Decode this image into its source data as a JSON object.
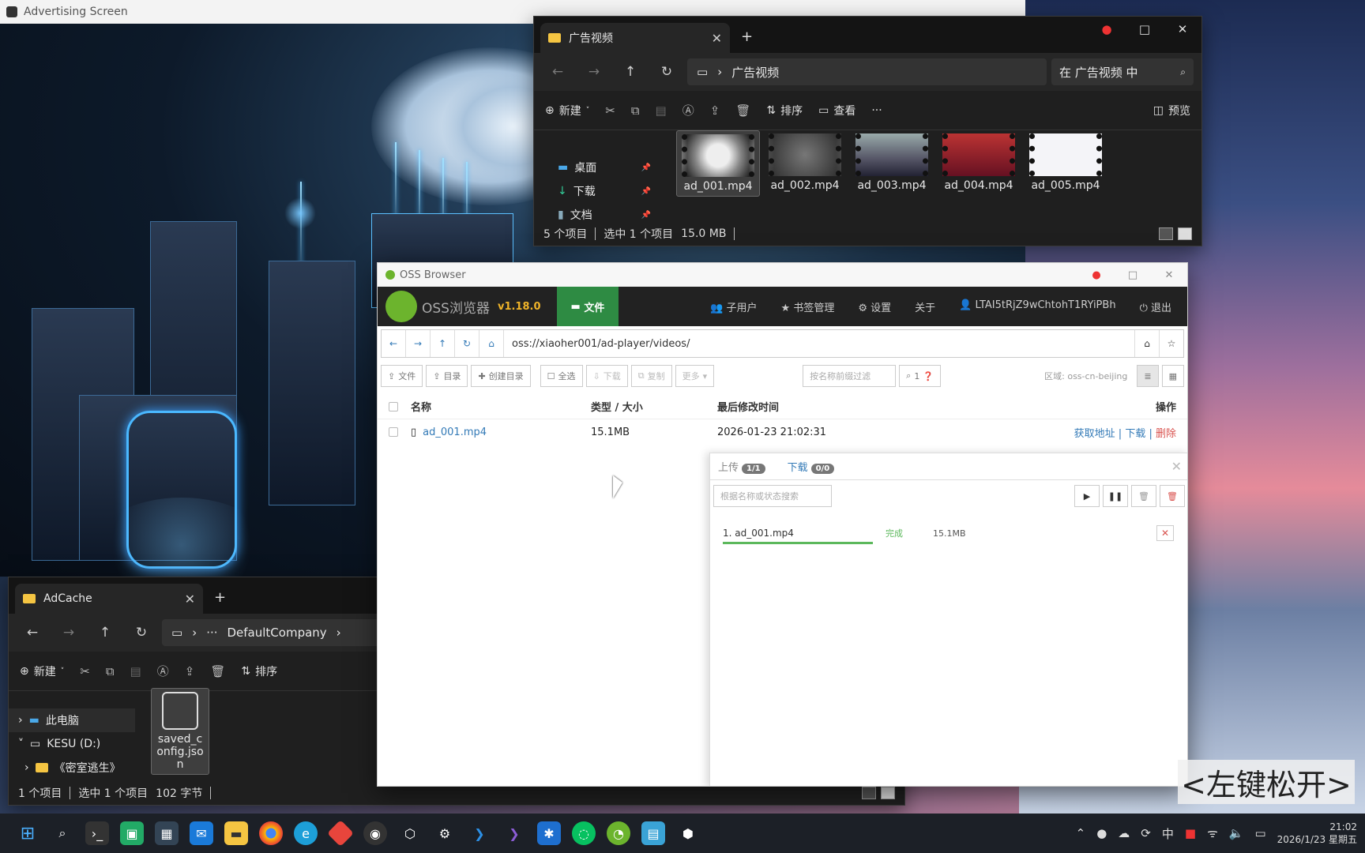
{
  "adv_window": {
    "title": "Advertising Screen"
  },
  "explorer_top": {
    "tab": "广告视频",
    "address": "广告视频",
    "search_placeholder": "在 广告视频 中",
    "cmd": {
      "new": "新建",
      "sort": "排序",
      "view": "查看",
      "more": "···",
      "preview": "预览"
    },
    "sidebar": [
      "桌面",
      "下载",
      "文档"
    ],
    "files": [
      "ad_001.mp4",
      "ad_002.mp4",
      "ad_003.mp4",
      "ad_004.mp4",
      "ad_005.mp4"
    ],
    "status": {
      "count": "5 个项目",
      "selected": "选中 1 个项目",
      "size": "15.0 MB"
    }
  },
  "explorer_bottom": {
    "tab": "AdCache",
    "address_prefix": "···",
    "address": "DefaultCompany",
    "cmd": {
      "new": "新建",
      "sort": "排序"
    },
    "tree": [
      "此电脑",
      "KESU (D:)",
      "《密室逃生》"
    ],
    "file": "saved_config.json",
    "status": {
      "count": "1 个项目",
      "selected": "选中 1 个项目",
      "size": "102 字节"
    }
  },
  "oss": {
    "window_title": "OSS Browser",
    "brand": "OSS浏览器",
    "version": "v1.18.0",
    "files_tab": "文件",
    "nav": [
      "子用户",
      "书签管理",
      "设置",
      "关于",
      "LTAI5tRjZ9wChtohT1RYiPBh",
      "退出"
    ],
    "path": "oss://xiaoher001/ad-player/videos/",
    "toolbar": {
      "upload_file": "文件",
      "upload_dir": "目录",
      "mkdir": "创建目录",
      "select_all": "全选",
      "download": "下载",
      "copy": "复制",
      "more": "更多",
      "filter_placeholder": "按名称前缀过滤",
      "page": "1",
      "region": "区域: oss-cn-beijing"
    },
    "table": {
      "headers": {
        "name": "名称",
        "type": "类型 / 大小",
        "time": "最后修改时间",
        "ops": "操作"
      },
      "rows": [
        {
          "name": "ad_001.mp4",
          "size": "15.1MB",
          "time": "2026-01-23 21:02:31"
        }
      ],
      "ops": {
        "get_url": "获取地址",
        "download": "下载",
        "delete": "删除"
      }
    },
    "transfer": {
      "upload_tab": "上传",
      "upload_count": "1/1",
      "download_tab": "下载",
      "download_count": "0/0",
      "search_placeholder": "根据名称或状态搜索",
      "item": {
        "name": "1. ad_001.mp4",
        "status": "完成",
        "size": "15.1MB",
        "progress": 1.0
      }
    }
  },
  "hint": "<左键松开>",
  "clock": {
    "time": "21:02",
    "date": "2026/1/23 星期五"
  },
  "tray": {
    "lang": "中"
  }
}
